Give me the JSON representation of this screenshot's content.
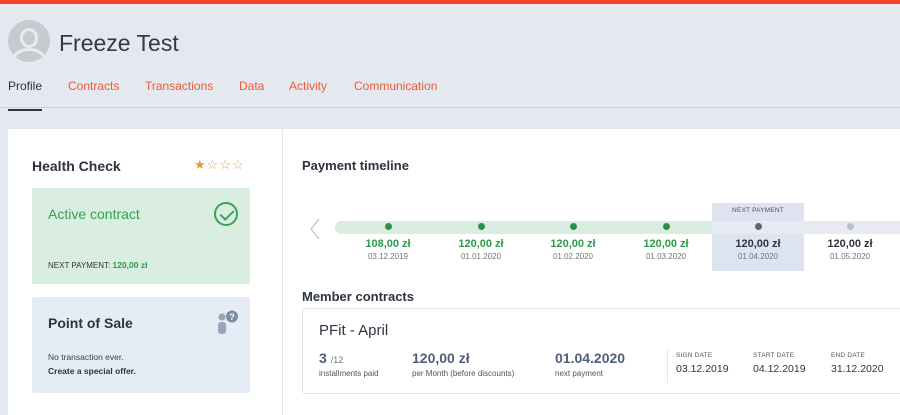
{
  "colors": {
    "accent": "#f0442f",
    "success": "#35a050",
    "tab_link": "#ef5a3a"
  },
  "header": {
    "title": "Freeze Test",
    "avatar_icon": "user-avatar-icon"
  },
  "tabs": [
    {
      "label": "Profile",
      "active": true
    },
    {
      "label": "Contracts",
      "active": false
    },
    {
      "label": "Transactions",
      "active": false
    },
    {
      "label": "Data",
      "active": false
    },
    {
      "label": "Activity",
      "active": false
    },
    {
      "label": "Communication",
      "active": false
    }
  ],
  "health_check": {
    "title": "Health Check",
    "rating": 1,
    "rating_max": 4,
    "active_card": {
      "label": "Active contract",
      "icon": "check-circle-icon",
      "next_payment_label": "NEXT PAYMENT:",
      "next_payment_value": "120,00 zł"
    },
    "pos_card": {
      "label": "Point of Sale",
      "icon": "person-question-icon",
      "line1": "No transaction ever.",
      "line2": "Create a special offer."
    }
  },
  "payment_timeline": {
    "title": "Payment timeline",
    "prev_icon": "chevron-left-icon",
    "next_payment_label": "NEXT PAYMENT",
    "points": [
      {
        "amount": "108,00 zł",
        "date": "03.12.2019",
        "state": "paid"
      },
      {
        "amount": "120,00 zł",
        "date": "01.01.2020",
        "state": "paid"
      },
      {
        "amount": "120,00 zł",
        "date": "01.02.2020",
        "state": "paid"
      },
      {
        "amount": "120,00 zł",
        "date": "01.03.2020",
        "state": "paid"
      },
      {
        "amount": "120,00 zł",
        "date": "01.04.2020",
        "state": "next"
      },
      {
        "amount": "120,00 zł",
        "date": "01.05.2020",
        "state": "future"
      }
    ]
  },
  "member_contracts": {
    "title": "Member contracts",
    "contract": {
      "name": "PFit - April",
      "installments_value": "3",
      "installments_total": "/12",
      "installments_label": "installments paid",
      "price": "120,00 zł",
      "price_label": "per Month (before discounts)",
      "next_payment": "01.04.2020",
      "next_payment_label": "next payment",
      "sign_date_label": "SIGN DATE",
      "sign_date": "03.12.2019",
      "start_date_label": "START DATE",
      "start_date": "04.12.2019",
      "end_date_label": "END DATE",
      "end_date": "31.12.2020"
    }
  }
}
